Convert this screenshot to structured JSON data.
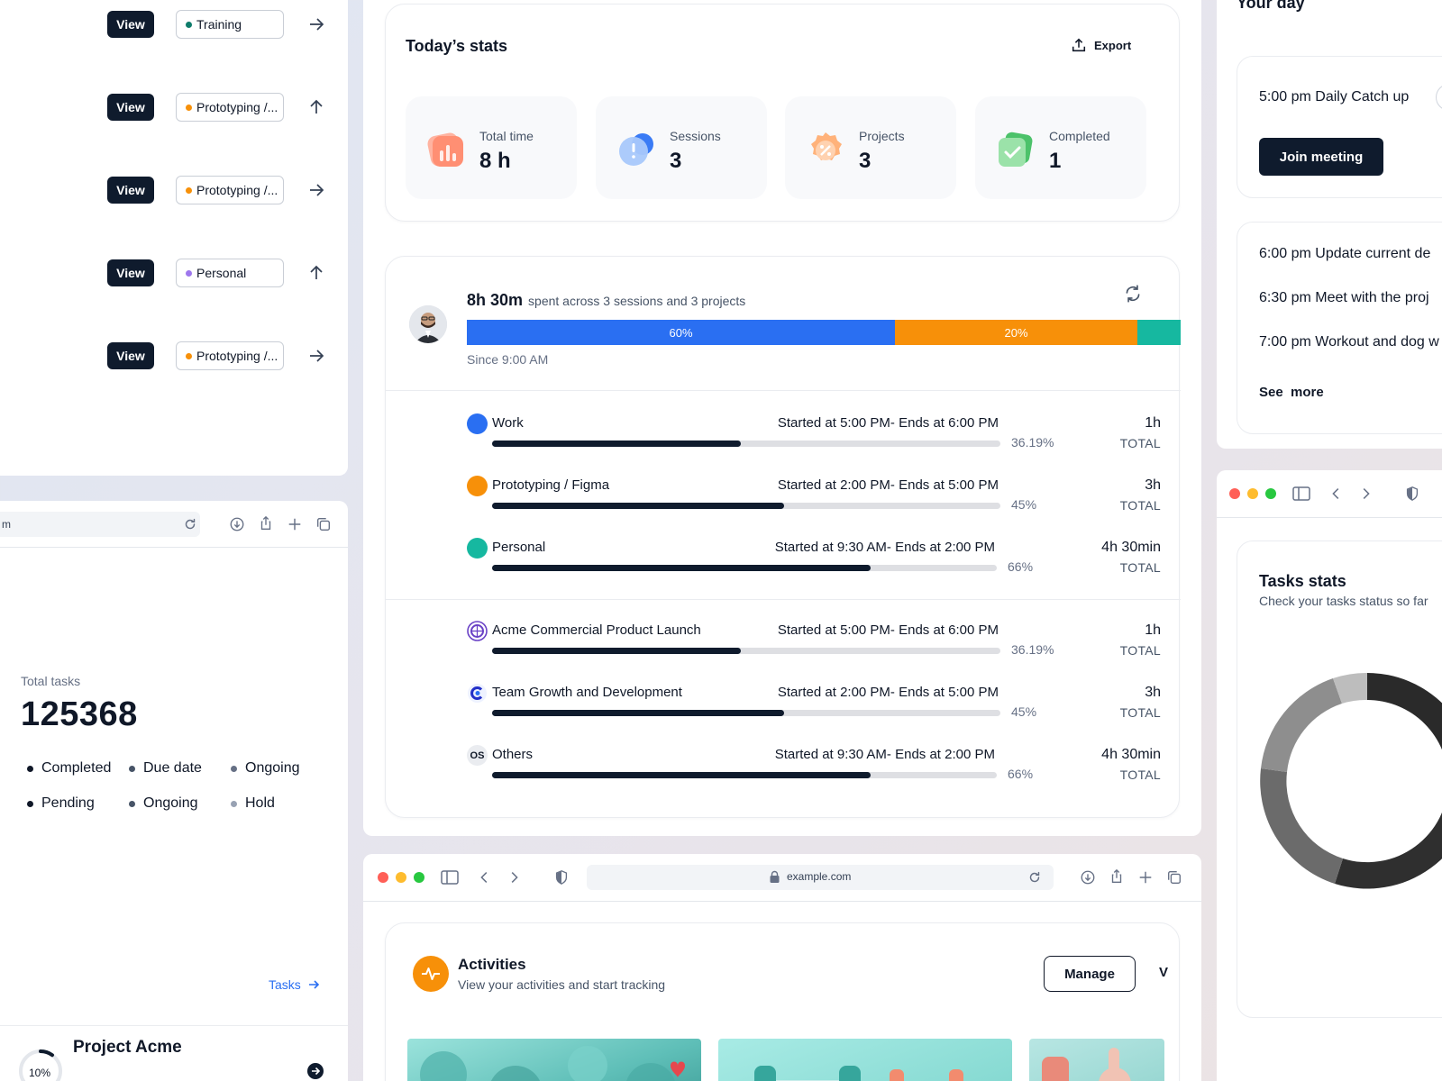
{
  "task_list": {
    "rows": [
      {
        "view_label": "View",
        "category": "Training",
        "dot_color": "#0e7c6b",
        "arrow": "right"
      },
      {
        "view_label": "View",
        "category": "Prototyping /...",
        "dot_color": "#f79009",
        "arrow": "up"
      },
      {
        "view_label": "View",
        "category": "Prototyping /...",
        "dot_color": "#f79009",
        "arrow": "right"
      },
      {
        "view_label": "View",
        "category": "Personal",
        "dot_color": "#9e77ed",
        "arrow": "up"
      },
      {
        "view_label": "View",
        "category": "Prototyping /...",
        "dot_color": "#f79009",
        "arrow": "right"
      }
    ]
  },
  "left_browser": {
    "url_fragment": "m",
    "total_tasks_label": "Total tasks",
    "total_tasks_value": "125368",
    "legend": [
      "Completed",
      "Due date",
      "Ongoing",
      "Pending",
      "Ongoing",
      "Hold"
    ],
    "tasks_link": "Tasks",
    "project": {
      "name": "Project Acme",
      "progress_label": "10%",
      "progress": 0.1
    }
  },
  "today_stats": {
    "title": "Today’s stats",
    "export_label": "Export",
    "stats": [
      {
        "label": "Total time",
        "value": "8 h",
        "icon": "chart-bars-icon"
      },
      {
        "label": "Sessions",
        "value": "3",
        "icon": "alert-bubble-icon"
      },
      {
        "label": "Projects",
        "value": "3",
        "icon": "badge-percent-icon"
      },
      {
        "label": "Completed",
        "value": "1",
        "icon": "check-shield-icon"
      }
    ]
  },
  "time_summary": {
    "total": "8h 30m",
    "subtitle": "spent across 3 sessions and 3 projects",
    "since": "Since 9:00 AM",
    "segments": [
      {
        "label": "60%",
        "share": 0.6,
        "color": "#2a6ff2"
      },
      {
        "label": "20%",
        "share": 0.34,
        "color": "#f79009"
      },
      {
        "label": "",
        "share": 0.06,
        "color": "#16b8a0"
      }
    ],
    "categories": [
      {
        "name": "Work",
        "range": "Started at 5:00 PM- Ends at 6:00 PM",
        "percent_label": "36.19%",
        "progress": 0.49,
        "duration": "1h",
        "total_label": "TOTAL",
        "icon_color": "#2a6ff2"
      },
      {
        "name": "Prototyping / Figma",
        "range": "Started at 2:00 PM- Ends at 5:00 PM",
        "percent_label": "45%",
        "progress": 0.575,
        "duration": "3h",
        "total_label": "TOTAL",
        "icon_color": "#f79009"
      },
      {
        "name": "Personal",
        "range": "Started at 9:30 AM- Ends at 2:00 PM",
        "percent_label": "66%",
        "progress": 0.75,
        "duration": "4h 30min",
        "total_label": "TOTAL",
        "icon_color": "#16b8a0"
      }
    ],
    "projects": [
      {
        "name": "Acme Commercial Product Launch",
        "range": "Started at 5:00 PM- Ends at 6:00 PM",
        "percent_label": "36.19%",
        "progress": 0.49,
        "duration": "1h",
        "total_label": "TOTAL",
        "icon": "acme-logo-icon"
      },
      {
        "name": "Team Growth and Development",
        "range": "Started at 2:00 PM- Ends at 5:00 PM",
        "percent_label": "45%",
        "progress": 0.575,
        "duration": "3h",
        "total_label": "TOTAL",
        "icon": "team-logo-icon"
      },
      {
        "name": "Others",
        "range": "Started at 9:30 AM- Ends at 2:00 PM",
        "percent_label": "66%",
        "progress": 0.75,
        "duration": "4h 30min",
        "total_label": "TOTAL",
        "icon_text": "OS"
      }
    ]
  },
  "center_browser": {
    "url": "example.com",
    "activities": {
      "title": "Activities",
      "subtitle": "View your activities and start tracking",
      "manage_label": "Manage",
      "cut_label": "V"
    }
  },
  "your_day": {
    "title": "Your day",
    "next_event": "5:00 pm Daily Catch up",
    "join_label": "Join meeting",
    "events": [
      "6:00 pm Update current de",
      "6:30 pm Meet with the proj",
      "7:00 pm Workout and dog w"
    ],
    "see_more": "See  more"
  },
  "tasks_stats": {
    "title": "Tasks stats",
    "subtitle": "Check your tasks status so far"
  }
}
